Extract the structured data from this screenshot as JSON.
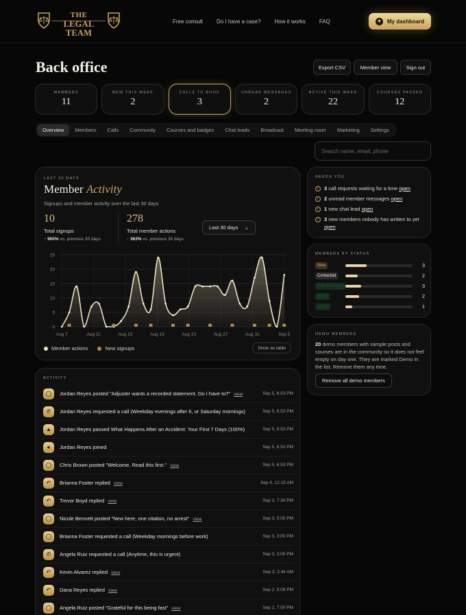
{
  "brand": {
    "line1": "THE",
    "line2": "LEGAL TEAM"
  },
  "nav": [
    "Free consult",
    "Do I have a case?",
    "How it works",
    "FAQ"
  ],
  "dashboard_button": {
    "label": "My dashboard",
    "icon": "plus-icon"
  },
  "page_title": "Back office",
  "toolbar": {
    "export": "Export CSV",
    "member_view": "Member view",
    "sign_out": "Sign out"
  },
  "stats": [
    {
      "label": "MEMBERS",
      "value": "11"
    },
    {
      "label": "NEW THIS WEEK",
      "value": "2"
    },
    {
      "label": "CALLS TO BOOK",
      "value": "3",
      "active": true
    },
    {
      "label": "UNREAD MESSAGES",
      "value": "2"
    },
    {
      "label": "ACTIVE THIS WEEK",
      "value": "22"
    },
    {
      "label": "COURSES PASSED",
      "value": "12"
    }
  ],
  "tabs": [
    "Overview",
    "Members",
    "Calls",
    "Community",
    "Courses and badges",
    "Chat leads",
    "Broadcast",
    "Meeting room",
    "Marketing",
    "Settings"
  ],
  "active_tab": "Overview",
  "search": {
    "placeholder": "Search name, email, phone"
  },
  "activity_chart": {
    "eyebrow": "LAST 30 DAYS",
    "title_a": "Member",
    "title_b": "Activity",
    "subtitle": "Signups and member activity over the last 30 days",
    "kpi1": {
      "value": "10",
      "label": "Total signups",
      "delta": "900%",
      "delta_suffix": " vs. previous 30 days"
    },
    "kpi2": {
      "value": "278",
      "label": "Total member actions",
      "delta": "363%",
      "delta_suffix": " vs. previous 30 days"
    },
    "range": "Last 30 days",
    "legend": [
      "Member actions",
      "New signups"
    ],
    "show_table": "Show as table"
  },
  "chart_data": {
    "type": "area",
    "x_tick_labels": [
      "Aug 7",
      "Aug 11",
      "Aug 15",
      "Aug 19",
      "Aug 23",
      "Aug 27",
      "Aug 31",
      "Sep 5"
    ],
    "y_ticks": [
      0,
      5,
      10,
      15,
      20,
      25
    ],
    "ylim": [
      0,
      25
    ],
    "series": [
      {
        "name": "Member actions",
        "color": "#f0e2bd",
        "values": [
          0,
          5,
          14,
          0,
          7,
          8,
          0,
          0,
          2,
          7,
          19,
          8,
          6,
          24,
          8,
          4,
          6,
          7,
          14,
          14,
          14,
          14,
          11,
          16,
          8,
          7,
          17,
          24,
          9,
          0,
          18
        ]
      },
      {
        "name": "New signups",
        "color": "#b58a45",
        "values": [
          0,
          1,
          0,
          0,
          0,
          0,
          0,
          1,
          0,
          0,
          1,
          0,
          1,
          0,
          0,
          1,
          0,
          1,
          0,
          0,
          1,
          0,
          0,
          1,
          0,
          0,
          1,
          0,
          1,
          0,
          1
        ]
      }
    ]
  },
  "activity": {
    "eyebrow": "ACTIVITY",
    "items": [
      {
        "icon": "chat-bubble-icon",
        "glyph": "◯",
        "text": "Jordan Reyes posted \"Adjuster wants a recorded statement. Do I have to?\"",
        "view": "view",
        "time": "Sep 5, 6:53 PM"
      },
      {
        "icon": "phone-icon",
        "glyph": "✆",
        "text": "Jordan Reyes requested a call (Weekday evenings after 6, or Saturday mornings)",
        "view": "",
        "time": "Sep 5, 6:53 PM"
      },
      {
        "icon": "graduation-cap-icon",
        "glyph": "▲",
        "text": "Jordan Reyes passed What Happens After an Accident: Your First 7 Days (100%)",
        "view": "",
        "time": "Sep 5, 6:53 PM"
      },
      {
        "icon": "user-icon",
        "glyph": "●",
        "text": "Jordan Reyes joined",
        "view": "",
        "time": "Sep 5, 6:53 PM"
      },
      {
        "icon": "chat-bubble-icon",
        "glyph": "◯",
        "text": "Chris Brown posted \"Welcome. Read this first.\"",
        "view": "view",
        "time": "Sep 5, 6:53 PM"
      },
      {
        "icon": "reply-icon",
        "glyph": "↶",
        "text": "Brianna Foster replied",
        "view": "view",
        "time": "Sep 4, 12:15 AM"
      },
      {
        "icon": "reply-icon",
        "glyph": "↶",
        "text": "Trevor Boyd replied",
        "view": "view",
        "time": "Sep 3, 7:34 PM"
      },
      {
        "icon": "chat-bubble-icon",
        "glyph": "◯",
        "text": "Nicole Bennett posted \"New here, one citation, no arrest\"",
        "view": "view",
        "time": "Sep 3, 5:00 PM"
      },
      {
        "icon": "chat-bubble-icon",
        "glyph": "◯",
        "text": "Brianna Foster requested a call (Weekday mornings before work)",
        "view": "",
        "time": "Sep 3, 3:00 PM"
      },
      {
        "icon": "phone-icon",
        "glyph": "✆",
        "text": "Angela Ruiz requested a call (Anytime, this is urgent)",
        "view": "",
        "time": "Sep 3, 3:00 PM"
      },
      {
        "icon": "reply-icon",
        "glyph": "↶",
        "text": "Kevin Alvarez replied",
        "view": "view",
        "time": "Sep 3, 2:44 AM"
      },
      {
        "icon": "reply-icon",
        "glyph": "↶",
        "text": "Dana Reyes replied",
        "view": "view",
        "time": "Sep 2, 9:09 PM"
      },
      {
        "icon": "chat-bubble-icon",
        "glyph": "◯",
        "text": "Angela Ruiz posted \"Grateful for this being fast\"",
        "view": "view",
        "time": "Sep 2, 7:00 PM"
      }
    ]
  },
  "needs_you": {
    "eyebrow": "NEEDS YOU",
    "items": [
      {
        "count": "3",
        "text": " call requests waiting for a time ",
        "link": "open"
      },
      {
        "count": "2",
        "text": " unread member messages ",
        "link": "open"
      },
      {
        "count": "1",
        "text": " new chat lead ",
        "link": "open"
      },
      {
        "count": "3",
        "text": " new members nobody has written to yet ",
        "link": "open"
      }
    ]
  },
  "members_by_status": {
    "eyebrow": "MEMBERS BY STATUS",
    "rows": [
      {
        "label": "New",
        "count": "3",
        "fraction": 0.32,
        "chip_bg": "#3d321d",
        "chip_fg": "#c9a45c"
      },
      {
        "label": "Contacted",
        "count": "2",
        "fraction": 0.18,
        "chip_bg": "#2a2a2a",
        "chip_fg": "#f3efe6"
      },
      {
        "label": "Call scheduled",
        "count": "3",
        "fraction": 0.23,
        "chip_bg": "#12301c",
        "chip_fg": "#1f4f2c"
      },
      {
        "label": "Client",
        "count": "2",
        "fraction": 0.2,
        "chip_bg": "#12301c",
        "chip_fg": "#1f4f2c"
      },
      {
        "label": "Active",
        "count": "1",
        "fraction": 0.1,
        "chip_bg": "#12301c",
        "chip_fg": "#1f4f2c"
      }
    ]
  },
  "demo_members": {
    "eyebrow": "DEMO MEMBERS",
    "count": "20",
    "text": " demo members with sample posts and courses are in the community so it does not feel empty on day one. They are marked Demo in the list. Remove them any time.",
    "button": "Remove all demo members"
  },
  "colors": {
    "gold": "#c9a45c",
    "gold_light": "#f1d99a",
    "background": "#070707"
  }
}
